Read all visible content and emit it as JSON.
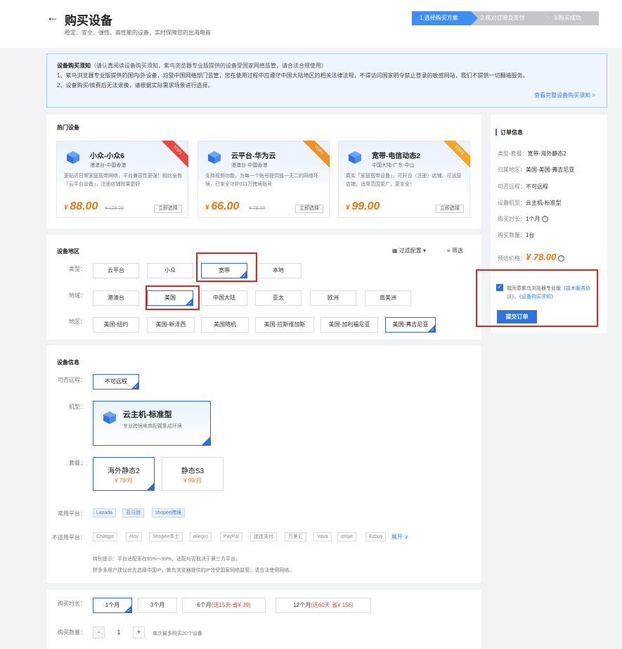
{
  "header": {
    "title": "购买设备",
    "subtitle": "稳定、安全、弹性、高性能的设备，实时保障您的出海电商",
    "steps": [
      "1.选择购买方案",
      "2.核对订单及支付",
      "3.购买成功"
    ]
  },
  "notice": {
    "title": "设备购买须知",
    "title_note": "（请认真阅读设备购买须知，紫鸟浏览器专业版提供的设备受国家网络监管，请合法合规使用）",
    "line1": "1、紫鸟浏览器专业版提供的国内/外设备，均受中国网络部门监管，您在使用过程中应遵守中国大陆地区的相关法律法规，不得访问国家明令禁止登录的敏感网站，我们不提供一切翻墙服务。",
    "line2": "2、设备购买/续费后无法退换，请根据实际需求场景进行选择。",
    "link": "查看完整设备购买须知 >"
  },
  "hot": {
    "title": "热门设备",
    "cards": [
      {
        "name": "小众-小众6",
        "region": "港澳台-中国香港",
        "desc": "更贴近日常家庭宽带网络，平台兼容性更强！相比全有「云平台设备」，注册店铺效果更好",
        "price": "88.00",
        "old": "¥ 128.00",
        "btn": "立即选择",
        "badge": "TOP1",
        "badge_color": "#e8473b"
      },
      {
        "name": "云平台-华为云",
        "region": "港澳台-中国香港",
        "desc": "支持视频功能，为每一个账号提供独一无二的网络环境，已安全守护311万跨境账号",
        "price": "66.00",
        "old": "¥ 78.00",
        "btn": "立即选择",
        "badge": "TOP2",
        "badge_color": "#f5901e"
      },
      {
        "name": "宽带-电信动态2",
        "region": "中国大陆-广东-中山",
        "desc": "真实「家庭宽带设备」，可开设（注册）店铺、可运营店铺，适用范围更广，更安全！",
        "price": "99.00",
        "old": "",
        "btn": "立即选择",
        "badge": "TOP3",
        "badge_color": "#f5a623"
      }
    ]
  },
  "region": {
    "title": "设备地区",
    "filter_config": "过滤配置",
    "filter": "筛选",
    "type_label": "类型：",
    "types": [
      "云平台",
      "小众",
      "宽带",
      "本地"
    ],
    "area_label": "地域：",
    "areas": [
      "港澳台",
      "美国",
      "中国大陆",
      "亚太",
      "欧洲",
      "南美洲"
    ],
    "zone_label": "地区：",
    "zones": [
      "美国-纽约",
      "美国-新泽西",
      "美国随机",
      "美国-拉斯维加斯",
      "美国-加利福尼亚",
      "美国-弗吉尼亚"
    ]
  },
  "device": {
    "title": "设备信息",
    "remote_label": "可否远程：",
    "remote_value": "不可远程",
    "model_label": "机型：",
    "model_name": "云主机-标准型",
    "model_desc": "专业跨境电商配置集成环境",
    "package_label": "套餐：",
    "packages": [
      {
        "name": "海外静态2",
        "price": "¥ 78/月"
      },
      {
        "name": "静态S3",
        "price": "¥ 99/月"
      }
    ],
    "common_label": "常用平台：",
    "common_platforms": [
      "Lazada",
      "亚马逊",
      "shopee跨境"
    ],
    "unsuitable_label": "不适用平台：",
    "unsuitable_platforms": [
      "Chatgpt",
      "etsy",
      "Shopee本土",
      "allegro",
      "PayPal",
      "连连支付",
      "万里汇",
      "Vova",
      "stripe",
      "Ezbuy"
    ],
    "expand": "展开",
    "tip1": "特别提示：平台适配率在95%～99%，适配与否取决于第三方平台。",
    "tip2": "拼多多用户建议优先选择中国IP，紫鸟浏览器提供的IP皆受国家网络监管，请合法使用网络。"
  },
  "purchase": {
    "duration_label": "购买时长：",
    "durations": [
      {
        "text": "1个月",
        "promo": ""
      },
      {
        "text": "3个月",
        "promo": ""
      },
      {
        "text": "6个月",
        "promo": "(送15天 省¥ 39)"
      },
      {
        "text": "12个月",
        "promo": "(送60天 省¥ 156)"
      }
    ],
    "qty_label": "购买数量：",
    "qty_minus": "-",
    "qty_value": "1",
    "qty_plus": "+",
    "qty_note": "单次最多购买20个设备"
  },
  "order": {
    "title": "订单信息",
    "rows": [
      {
        "k": "类型-套餐：",
        "v": "宽带-海外静态2"
      },
      {
        "k": "归属地区：",
        "v": "美国-美国-弗吉尼亚"
      },
      {
        "k": "可否远程：",
        "v": "不可远程"
      },
      {
        "k": "设备机型：",
        "v": "云主机-标准型"
      },
      {
        "k": "购买时长：",
        "v": "1个月"
      },
      {
        "k": "购买数量：",
        "v": "1台"
      }
    ],
    "price_label": "预估价格：",
    "price": "¥ 78.00",
    "agree_prefix": "我同意紫鸟浏览器专业版",
    "agree_link": "《技术服务协议》、《设备购买须知》",
    "submit": "提交订单"
  },
  "colors": {
    "accent": "#2f73e0",
    "price": "#f0780a",
    "highlight": "#e02424"
  }
}
